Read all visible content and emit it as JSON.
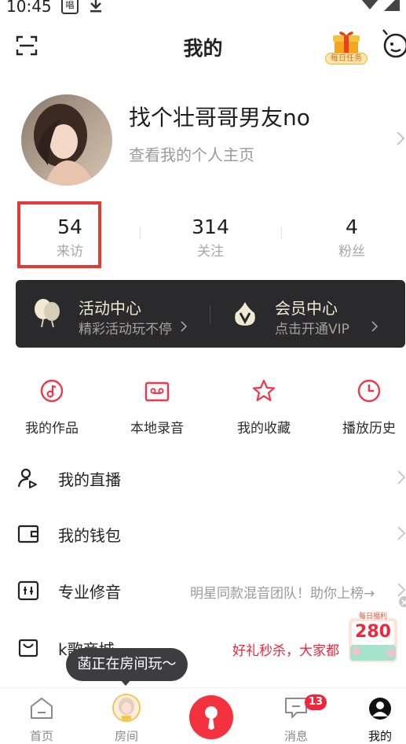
{
  "status_bar": {
    "time": "10:45",
    "app_badge": "唱"
  },
  "header": {
    "title": "我的",
    "daily_task_label": "每日任务"
  },
  "profile": {
    "username": "找个壮哥哥男友no",
    "homepage_link": "查看我的个人主页"
  },
  "stats": [
    {
      "value": "54",
      "label": "来访"
    },
    {
      "value": "314",
      "label": "关注"
    },
    {
      "value": "4",
      "label": "粉丝"
    }
  ],
  "banner": {
    "activity": {
      "title": "活动中心",
      "subtitle": "精彩活动玩不停"
    },
    "vip": {
      "title": "会员中心",
      "subtitle": "点击开通VIP"
    }
  },
  "quick_actions": [
    {
      "label": "我的作品",
      "icon": "music-disc-icon"
    },
    {
      "label": "本地录音",
      "icon": "cassette-icon"
    },
    {
      "label": "我的收藏",
      "icon": "star-icon"
    },
    {
      "label": "播放历史",
      "icon": "clock-icon"
    }
  ],
  "menu": [
    {
      "label": "我的直播",
      "icon": "live-user-icon",
      "extra": ""
    },
    {
      "label": "我的钱包",
      "icon": "wallet-icon",
      "extra": ""
    },
    {
      "label": "专业修音",
      "icon": "audio-tune-icon",
      "extra": "明星同款混音团队！助你上榜→"
    },
    {
      "label": "k歌商城",
      "icon": "shopping-bag-icon",
      "extra": "好礼秒杀，大家都"
    }
  ],
  "promo": {
    "top_text": "每日福利",
    "amount": "280"
  },
  "tooltip": {
    "text": "菡正在房间玩～"
  },
  "bottom_nav": {
    "home": "首页",
    "room": "房间",
    "messages": "消息",
    "messages_badge": "13",
    "mine": "我的"
  },
  "colors": {
    "accent": "#f3323e",
    "highlight_box": "#e53935",
    "banner_bg": "#2a2a2d",
    "banner_title": "#f0ead2"
  }
}
